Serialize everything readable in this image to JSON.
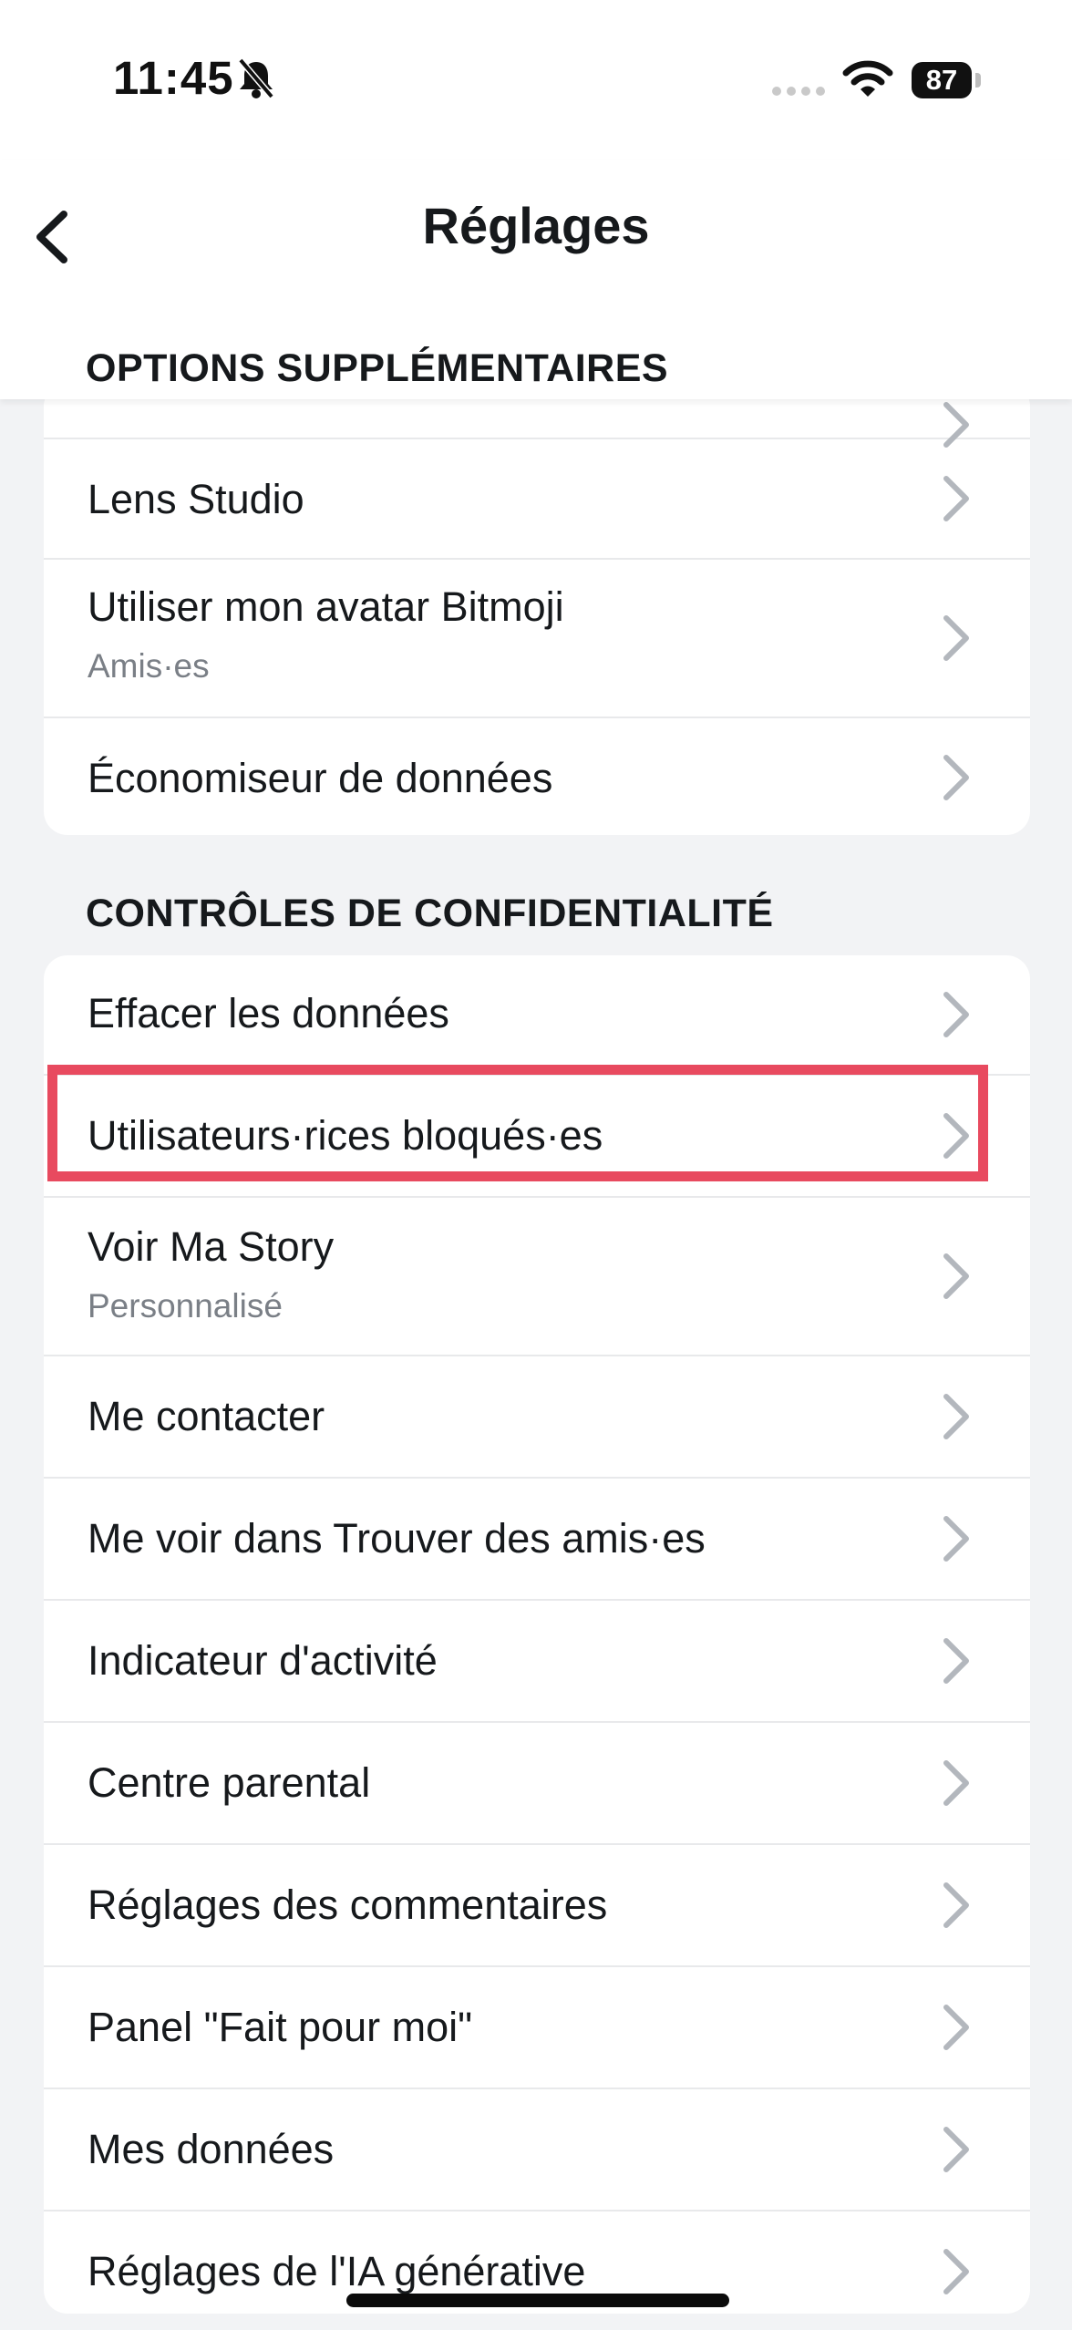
{
  "status_bar": {
    "time": "11:45",
    "battery": "87"
  },
  "header": {
    "title": "Réglages"
  },
  "sections": [
    {
      "title": "OPTIONS SUPPLÉMENTAIRES",
      "items": [
        {
          "label": "Lens Studio"
        },
        {
          "label": "Utiliser mon avatar Bitmoji",
          "sublabel": "Amis·es"
        },
        {
          "label": "Économiseur de données"
        }
      ]
    },
    {
      "title": "CONTRÔLES DE CONFIDENTIALITÉ",
      "items": [
        {
          "label": "Effacer les données"
        },
        {
          "label": "Utilisateurs·rices bloqués·es"
        },
        {
          "label": "Voir Ma Story",
          "sublabel": "Personnalisé"
        },
        {
          "label": "Me contacter"
        },
        {
          "label": "Me voir dans Trouver des amis·es"
        },
        {
          "label": "Indicateur d'activité"
        },
        {
          "label": "Centre parental"
        },
        {
          "label": "Réglages des commentaires"
        },
        {
          "label": "Panel \"Fait pour moi\""
        },
        {
          "label": "Mes données"
        },
        {
          "label": "Réglages de l'IA générative"
        }
      ]
    }
  ],
  "colors": {
    "highlight": "#e84a5f",
    "background": "#f2f3f5",
    "chevron": "#b3b7bd"
  },
  "icons": [
    "bell-slash-icon",
    "cellular-dots-icon",
    "wifi-icon",
    "battery-icon",
    "back-chevron-icon",
    "chevron-right-icon"
  ]
}
